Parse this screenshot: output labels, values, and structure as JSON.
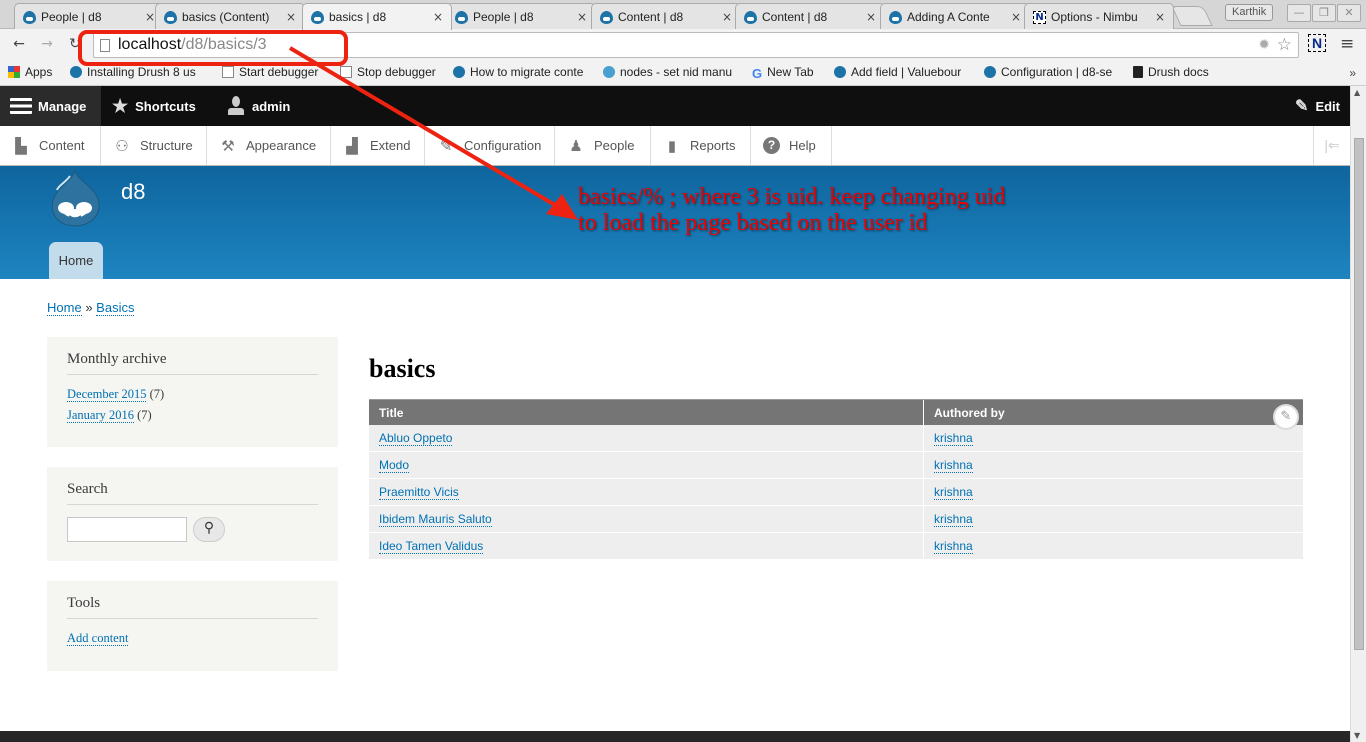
{
  "browser": {
    "tabs": [
      {
        "title": "People | d8",
        "favicon": "drupal-icon",
        "active": false
      },
      {
        "title": "basics (Content)",
        "favicon": "drupal-icon",
        "active": false
      },
      {
        "title": "basics | d8",
        "favicon": "drupal-icon",
        "active": true
      },
      {
        "title": "People | d8",
        "favicon": "drupal-icon",
        "active": false
      },
      {
        "title": "Content | d8",
        "favicon": "drupal-icon",
        "active": false
      },
      {
        "title": "Content | d8",
        "favicon": "drupal-icon",
        "active": false
      },
      {
        "title": "Adding A Conte",
        "favicon": "drupal-icon",
        "active": false
      },
      {
        "title": "Options - Nimbu",
        "favicon": "nimbus-icon",
        "active": false
      }
    ],
    "tab_close_glyph": "×",
    "profile_name": "Karthik",
    "window_controls": {
      "minimize": "—",
      "restore": "❐",
      "close": "✕"
    },
    "nav": {
      "back": "◆",
      "forward": "◈",
      "reload": "↻"
    },
    "url_host": "localhost",
    "url_path": "/d8/basics/3",
    "extensions": {
      "nimbus": "N",
      "menu": "≡",
      "bug": "✹",
      "star": "☆"
    },
    "bookmarks": [
      {
        "label": "Apps",
        "icon": "apps-icon"
      },
      {
        "label": "Installing Drush 8 us",
        "icon": "drupal-icon"
      },
      {
        "label": "Start debugger",
        "icon": "page-icon"
      },
      {
        "label": "Stop debugger",
        "icon": "page-icon"
      },
      {
        "label": "How to migrate conte",
        "icon": "drupal-icon"
      },
      {
        "label": "nodes - set nid manu",
        "icon": "drop-icon"
      },
      {
        "label": "New Tab",
        "icon": "google-icon"
      },
      {
        "label": "Add field | Valuebour",
        "icon": "drupal-icon"
      },
      {
        "label": "Configuration | d8-se",
        "icon": "drupal-icon"
      },
      {
        "label": "Drush docs",
        "icon": "book-icon"
      }
    ],
    "bookmarks_more": "»"
  },
  "drupal_toolbar": {
    "manage": "Manage",
    "shortcuts": "Shortcuts",
    "user": "admin",
    "edit": "Edit",
    "tray": [
      {
        "label": "Content",
        "icon": "content-icon",
        "glyph": "▙"
      },
      {
        "label": "Structure",
        "icon": "structure-icon",
        "glyph": "⚇"
      },
      {
        "label": "Appearance",
        "icon": "appearance-icon",
        "glyph": "⚒"
      },
      {
        "label": "Extend",
        "icon": "extend-icon",
        "glyph": "▟"
      },
      {
        "label": "Configuration",
        "icon": "configuration-icon",
        "glyph": "✎"
      },
      {
        "label": "People",
        "icon": "people-icon",
        "glyph": "♟"
      },
      {
        "label": "Reports",
        "icon": "reports-icon",
        "glyph": "▮"
      },
      {
        "label": "Help",
        "icon": "help-icon",
        "glyph": "?"
      }
    ],
    "collapse_glyph": "|⇐"
  },
  "site": {
    "name": "d8",
    "main_menu": [
      "Home"
    ]
  },
  "annotation": {
    "line1": "basics/% ; where 3 is uid. keep changing uid",
    "line2": "to load the page based on the user id",
    "color": "#ee0000"
  },
  "breadcrumb": {
    "items": [
      "Home",
      "Basics"
    ],
    "separator": "»"
  },
  "sidebar": {
    "archive": {
      "title": "Monthly archive",
      "items": [
        {
          "label": "December 2015",
          "count": "(7)"
        },
        {
          "label": "January 2016",
          "count": "(7)"
        }
      ]
    },
    "search": {
      "title": "Search",
      "value": "",
      "button_glyph": "🔍"
    },
    "tools": {
      "title": "Tools",
      "items": [
        "Add content"
      ]
    }
  },
  "main": {
    "title": "basics",
    "table": {
      "columns": [
        "Title",
        "Authored by"
      ],
      "rows": [
        [
          "Abluo Oppeto",
          "krishna"
        ],
        [
          "Modo",
          "krishna"
        ],
        [
          "Praemitto Vicis",
          "krishna"
        ],
        [
          "Ibidem Mauris Saluto",
          "krishna"
        ],
        [
          "Ideo Tamen Validus",
          "krishna"
        ]
      ]
    },
    "edit_glyph": "✎"
  },
  "colors": {
    "header_top": "#0f659e",
    "header_bottom": "#1d84c0",
    "link": "#0071b3",
    "table_header": "#757575",
    "admin_bar": "#0f0f0f"
  }
}
